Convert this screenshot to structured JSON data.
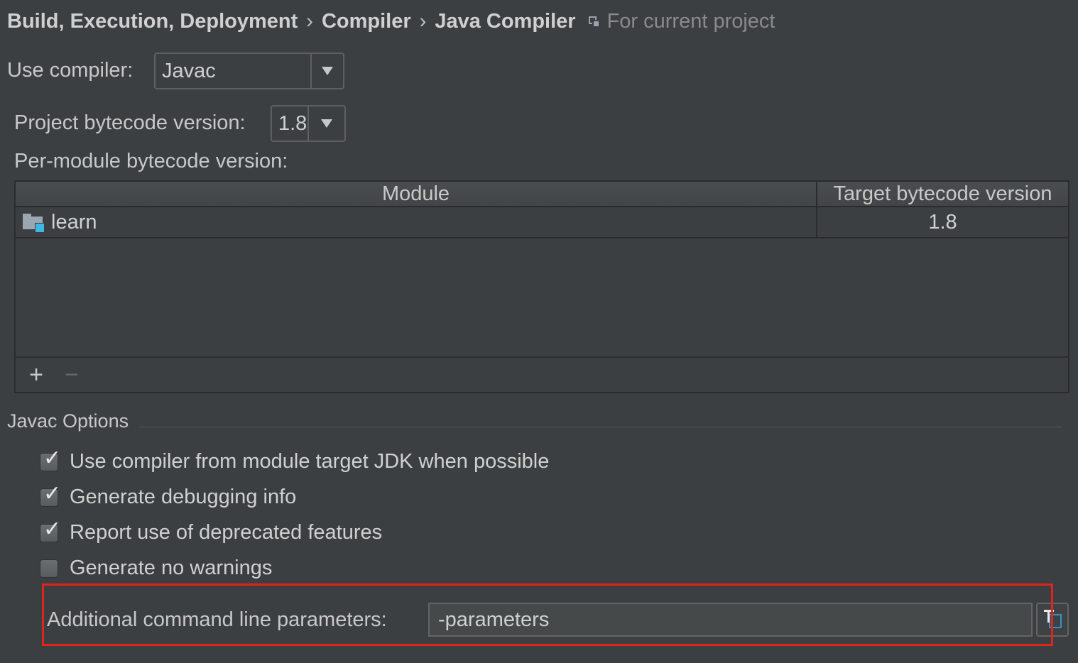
{
  "breadcrumb": {
    "items": [
      "Build, Execution, Deployment",
      "Compiler",
      "Java Compiler"
    ],
    "separator": "›",
    "scope_text": "For current project",
    "scope_icon": "project-scope-icon"
  },
  "compiler": {
    "label": "Use compiler:",
    "value": "Javac"
  },
  "bytecode": {
    "label": "Project bytecode version:",
    "value": "1.8"
  },
  "per_module": {
    "label": "Per-module bytecode version:",
    "columns": [
      "Module",
      "Target bytecode version"
    ],
    "rows": [
      {
        "module": "learn",
        "version": "1.8",
        "icon": "module-folder-icon"
      }
    ],
    "add_label": "+",
    "remove_label": "−"
  },
  "javac_options": {
    "title": "Javac Options",
    "checkboxes": [
      {
        "label": "Use compiler from module target JDK when possible",
        "checked": true
      },
      {
        "label": "Generate debugging info",
        "checked": true
      },
      {
        "label": "Report use of deprecated features",
        "checked": true
      },
      {
        "label": "Generate no warnings",
        "checked": false
      }
    ],
    "params_label": "Additional command line parameters:",
    "params_value": "-parameters"
  },
  "colors": {
    "background": "#3c3f41",
    "highlight": "#e1251b",
    "accent": "#40b6e0"
  }
}
